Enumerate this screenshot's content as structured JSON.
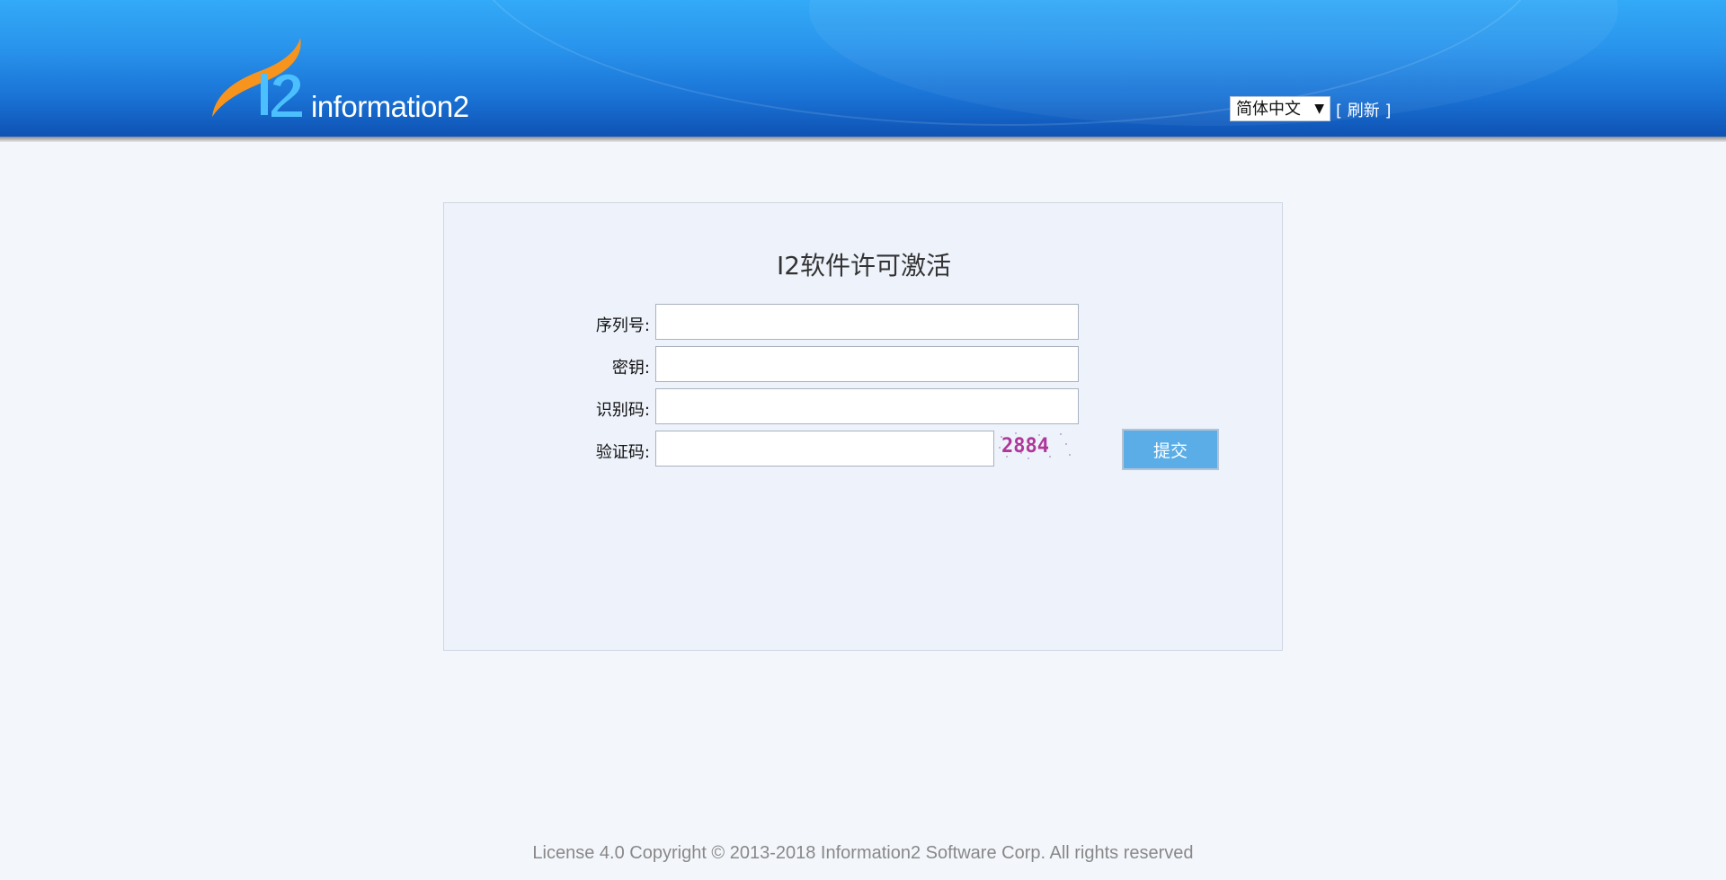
{
  "header": {
    "logo_text": "information2",
    "language": "简体中文",
    "refresh_open": "[ ",
    "refresh_label": "刷新",
    "refresh_close": " ]"
  },
  "form": {
    "title": "I2软件许可激活",
    "serial_label": "序列号:",
    "key_label": "密钥:",
    "id_label": "识别码:",
    "captcha_label": "验证码:",
    "captcha_text": "2884",
    "submit_label": "提交"
  },
  "footer": {
    "copyright": "License 4.0 Copyright © 2013-2018 Information2 Software Corp. All rights reserved"
  },
  "colors": {
    "header_top": "#33aaf7",
    "header_bottom": "#0e52b4",
    "submit_bg": "#5aade6",
    "panel_bg": "#edf2fb"
  }
}
